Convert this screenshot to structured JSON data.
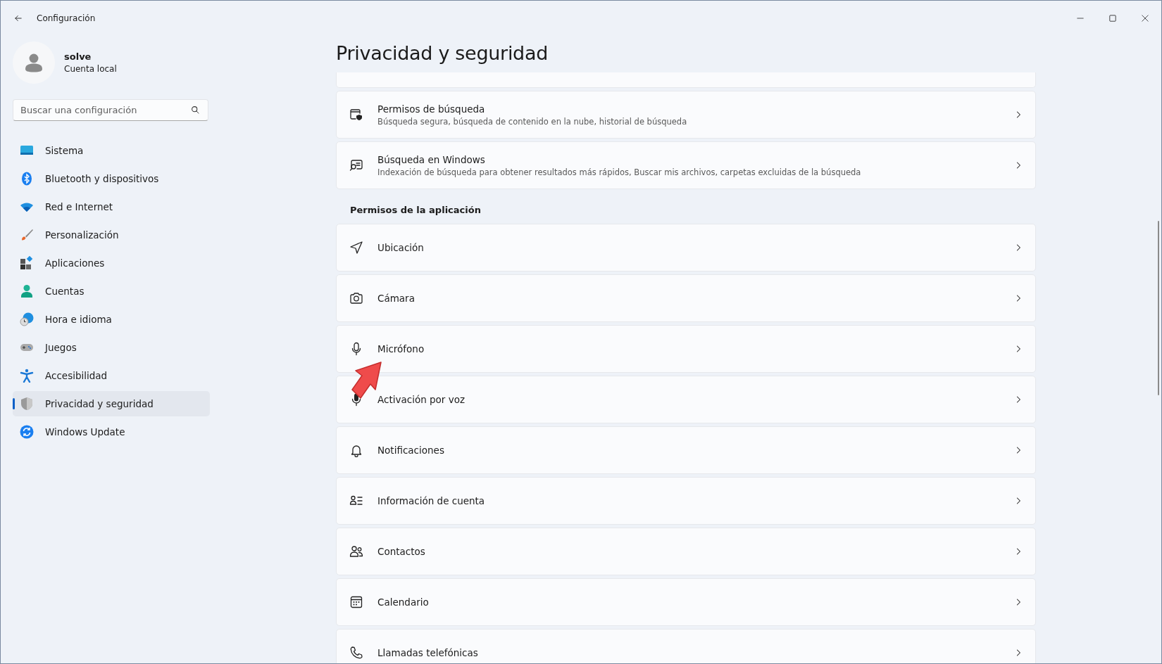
{
  "window": {
    "title": "Configuración"
  },
  "user": {
    "name": "solve",
    "account": "Cuenta local"
  },
  "search": {
    "placeholder": "Buscar una configuración"
  },
  "sidebar": {
    "items": [
      {
        "label": "Sistema",
        "selected": false
      },
      {
        "label": "Bluetooth y dispositivos",
        "selected": false
      },
      {
        "label": "Red e Internet",
        "selected": false
      },
      {
        "label": "Personalización",
        "selected": false
      },
      {
        "label": "Aplicaciones",
        "selected": false
      },
      {
        "label": "Cuentas",
        "selected": false
      },
      {
        "label": "Hora e idioma",
        "selected": false
      },
      {
        "label": "Juegos",
        "selected": false
      },
      {
        "label": "Accesibilidad",
        "selected": false
      },
      {
        "label": "Privacidad y seguridad",
        "selected": true
      },
      {
        "label": "Windows Update",
        "selected": false
      }
    ]
  },
  "page_title": "Privacidad y seguridad",
  "search_cards": [
    {
      "title": "Permisos de búsqueda",
      "description": "Búsqueda segura, búsqueda de contenido en la nube, historial de búsqueda"
    },
    {
      "title": "Búsqueda en Windows",
      "description": "Indexación de búsqueda para obtener resultados más rápidos, Buscar mis archivos, carpetas excluidas de la búsqueda"
    }
  ],
  "app_permissions": {
    "heading": "Permisos de la aplicación",
    "items": [
      {
        "title": "Ubicación"
      },
      {
        "title": "Cámara"
      },
      {
        "title": "Micrófono"
      },
      {
        "title": "Activación por voz"
      },
      {
        "title": "Notificaciones"
      },
      {
        "title": "Información de cuenta"
      },
      {
        "title": "Contactos"
      },
      {
        "title": "Calendario"
      },
      {
        "title": "Llamadas telefónicas"
      }
    ]
  }
}
